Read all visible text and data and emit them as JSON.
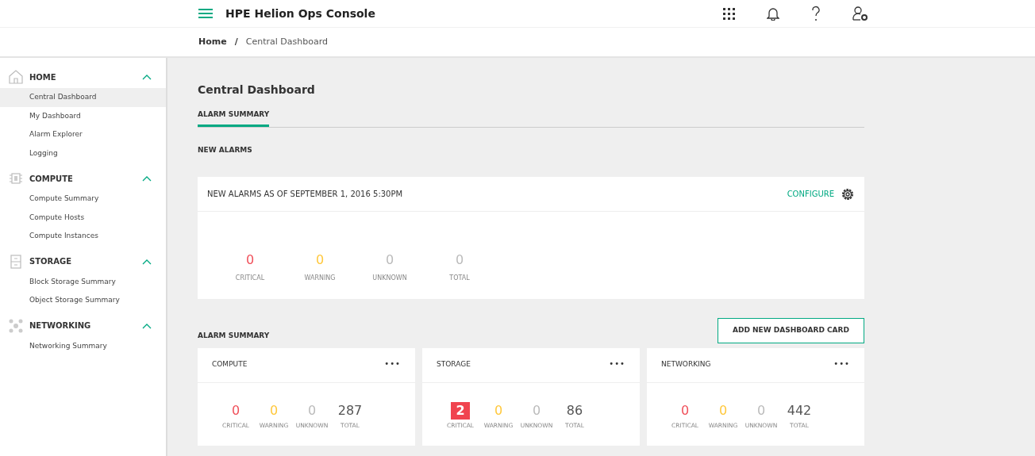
{
  "header": {
    "title": "HPE Helion Ops Console"
  },
  "breadcrumb": [
    {
      "label": "Home",
      "current": false
    },
    {
      "label": "/",
      "current": false
    },
    {
      "label": "Central Dashboard",
      "current": true
    }
  ],
  "sidebar": {
    "sections": [
      {
        "label": "HOME",
        "expanded": true,
        "items": [
          {
            "label": "Central Dashboard",
            "selected": true
          },
          {
            "label": "My Dashboard",
            "selected": false
          },
          {
            "label": "Alarm Explorer",
            "selected": false
          },
          {
            "label": "Logging",
            "selected": false
          }
        ]
      },
      {
        "label": "COMPUTE",
        "expanded": true,
        "items": [
          {
            "label": "Compute Summary",
            "selected": false
          },
          {
            "label": "Compute Hosts",
            "selected": false
          },
          {
            "label": "Compute Instances",
            "selected": false
          }
        ]
      },
      {
        "label": "STORAGE",
        "expanded": true,
        "items": [
          {
            "label": "Block Storage Summary",
            "selected": false
          },
          {
            "label": "Object Storage Summary",
            "selected": false
          }
        ]
      },
      {
        "label": "NETWORKING",
        "expanded": true,
        "items": [
          {
            "label": "Networking Summary",
            "selected": false
          }
        ]
      }
    ]
  },
  "page": {
    "title": "Central Dashboard",
    "tabs": [
      {
        "label": "ALARM SUMMARY",
        "selected": true
      }
    ],
    "new_alarms": {
      "heading": "NEW ALARMS",
      "card_title": "NEW ALARMS AS OF SEPTEMBER 1, 2016 5:30PM",
      "configure": "CONFIGURE",
      "stats": [
        {
          "kind": "critical",
          "value": "0",
          "label": "CRITICAL",
          "highlighted": false
        },
        {
          "kind": "warning",
          "value": "0",
          "label": "WARNING",
          "highlighted": false
        },
        {
          "kind": "unknown",
          "value": "0",
          "label": "UNKNOWN",
          "highlighted": false
        },
        {
          "kind": "total_muted",
          "value": "0",
          "label": "TOTAL",
          "highlighted": false
        }
      ]
    },
    "alarm_summary": {
      "heading": "ALARM SUMMARY",
      "add_button": "ADD NEW DASHBOARD CARD",
      "menu": "•••",
      "cards": [
        {
          "title": "COMPUTE",
          "stats": [
            {
              "kind": "critical",
              "value": "0",
              "label": "CRITICAL",
              "highlighted": false
            },
            {
              "kind": "warning",
              "value": "0",
              "label": "WARNING",
              "highlighted": false
            },
            {
              "kind": "unknown",
              "value": "0",
              "label": "UNKNOWN",
              "highlighted": false
            },
            {
              "kind": "total",
              "value": "287",
              "label": "TOTAL",
              "highlighted": false
            }
          ]
        },
        {
          "title": "STORAGE",
          "stats": [
            {
              "kind": "critical",
              "value": "2",
              "label": "CRITICAL",
              "highlighted": true
            },
            {
              "kind": "warning",
              "value": "0",
              "label": "WARNING",
              "highlighted": false
            },
            {
              "kind": "unknown",
              "value": "0",
              "label": "UNKNOWN",
              "highlighted": false
            },
            {
              "kind": "total",
              "value": "86",
              "label": "TOTAL",
              "highlighted": false
            }
          ]
        },
        {
          "title": "NETWORKING",
          "stats": [
            {
              "kind": "critical",
              "value": "0",
              "label": "CRITICAL",
              "highlighted": false
            },
            {
              "kind": "warning",
              "value": "0",
              "label": "WARNING",
              "highlighted": false
            },
            {
              "kind": "unknown",
              "value": "0",
              "label": "UNKNOWN",
              "highlighted": false
            },
            {
              "kind": "total",
              "value": "442",
              "label": "TOTAL",
              "highlighted": false
            }
          ]
        }
      ]
    }
  }
}
